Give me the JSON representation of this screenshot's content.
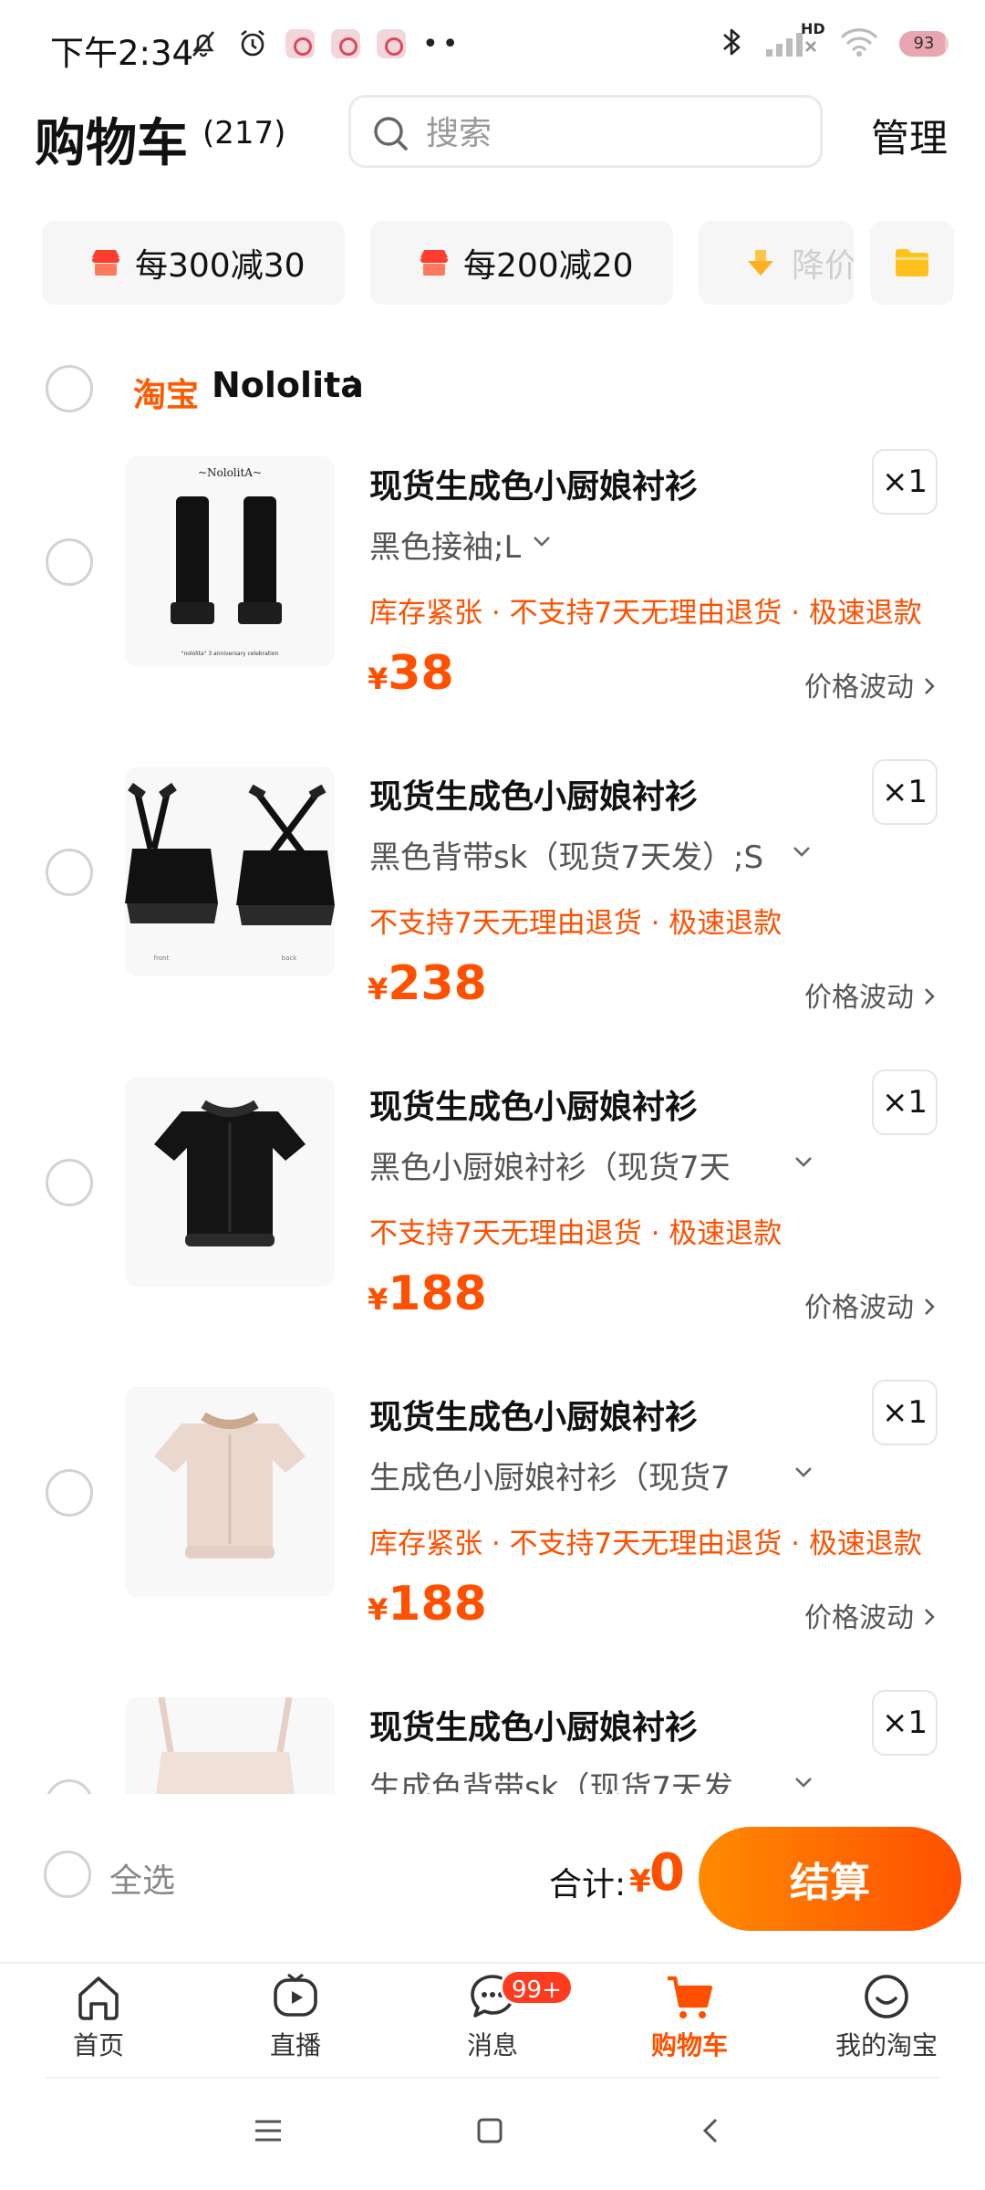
{
  "status_bar": {
    "time": "下午2:34",
    "battery": "93",
    "battery_level": 0.93,
    "network_label": "HD"
  },
  "header": {
    "title": "购物车",
    "count": "(217)",
    "search_placeholder": "搜索",
    "manage_label": "管理"
  },
  "coupons": [
    {
      "label": "每300减30",
      "icon": "store-icon"
    },
    {
      "label": "每200减20",
      "icon": "store-icon"
    },
    {
      "label": "降价",
      "icon": "price-drop-icon"
    }
  ],
  "folder_icon": "folder-icon",
  "shop": {
    "badge": "淘宝",
    "name": "Nololita"
  },
  "items": [
    {
      "title": "现货生成色小厨娘衬衫",
      "sku": "黑色接袖;L",
      "tags": "库存紧张 · 不支持7天无理由退货 · 极速退款",
      "currency": "¥",
      "price": "38",
      "fluct": "价格波动",
      "qty": "×1",
      "thumb_brand": "~NololitA~",
      "thumb_caption": "\"nololita\" 3 anniversary celebration"
    },
    {
      "title": "现货生成色小厨娘衬衫",
      "sku": "黑色背带sk（现货7天发）;S",
      "tags": "不支持7天无理由退货 · 极速退款",
      "currency": "¥",
      "price": "238",
      "fluct": "价格波动",
      "qty": "×1",
      "thumb_caption_left": "front",
      "thumb_caption_right": "back"
    },
    {
      "title": "现货生成色小厨娘衬衫",
      "sku": "黑色小厨娘衬衫（现货7天",
      "tags": "不支持7天无理由退货 · 极速退款",
      "currency": "¥",
      "price": "188",
      "fluct": "价格波动",
      "qty": "×1"
    },
    {
      "title": "现货生成色小厨娘衬衫",
      "sku": "生成色小厨娘衬衫（现货7",
      "tags": "库存紧张 · 不支持7天无理由退货 · 极速退款",
      "currency": "¥",
      "price": "188",
      "fluct": "价格波动",
      "qty": "×1"
    },
    {
      "title": "现货生成色小厨娘衬衫",
      "sku": "生成色背带sk（现货7天发",
      "qty": "×1"
    }
  ],
  "checkout": {
    "select_all": "全选",
    "total_label": "合计:",
    "currency": "¥",
    "total": "0",
    "button": "结算"
  },
  "tabs": [
    {
      "label": "首页",
      "icon": "home-icon"
    },
    {
      "label": "直播",
      "icon": "live-icon"
    },
    {
      "label": "消息",
      "icon": "message-icon",
      "badge": "99+"
    },
    {
      "label": "购物车",
      "icon": "cart-icon",
      "active": true
    },
    {
      "label": "我的淘宝",
      "icon": "profile-icon"
    }
  ],
  "colors": {
    "accent": "#ff5000",
    "button_gradient_start": "#ff8a00",
    "button_gradient_end": "#ff4f00"
  }
}
